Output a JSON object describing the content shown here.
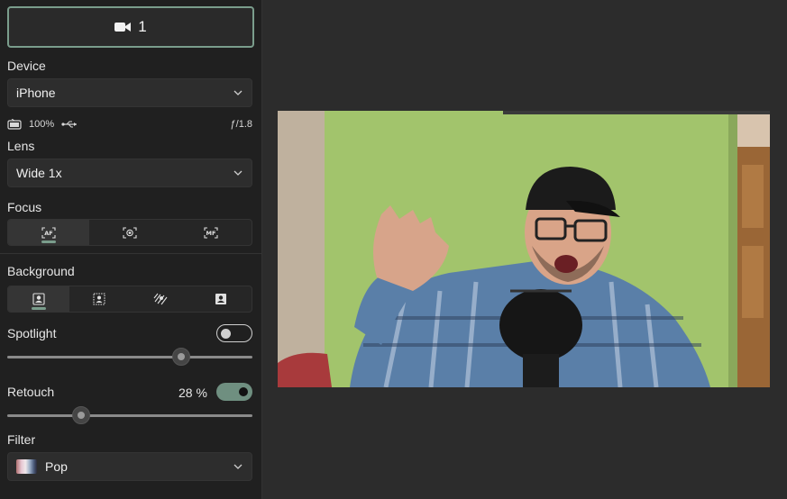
{
  "camera": {
    "number": "1"
  },
  "device": {
    "label": "Device",
    "selected": "iPhone"
  },
  "status": {
    "battery": "100%",
    "aperture": "ƒ/1.8"
  },
  "lens": {
    "label": "Lens",
    "selected": "Wide 1x"
  },
  "focus": {
    "label": "Focus",
    "options": [
      "auto-focus",
      "face-focus",
      "manual-focus"
    ],
    "selected_index": 0
  },
  "background": {
    "label": "Background",
    "options": [
      "portrait",
      "blur",
      "remove",
      "replace"
    ],
    "selected_index": 0
  },
  "spotlight": {
    "label": "Spotlight",
    "enabled": false,
    "level": 0.71
  },
  "retouch": {
    "label": "Retouch",
    "value_text": "28 %",
    "enabled": true,
    "level": 0.3
  },
  "filter": {
    "label": "Filter",
    "selected": "Pop"
  },
  "colors": {
    "accent": "#7a9d8c",
    "panel": "#202020",
    "main": "#2c2c2c"
  }
}
